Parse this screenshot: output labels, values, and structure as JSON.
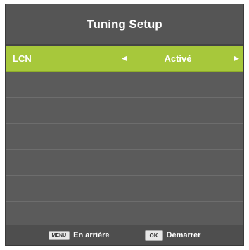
{
  "header": {
    "title": "Tuning Setup"
  },
  "menu": {
    "items": [
      {
        "label": "LCN",
        "value": "Activé"
      }
    ]
  },
  "footer": {
    "back": {
      "key": "MENU",
      "label": "En arrière"
    },
    "start": {
      "key": "OK",
      "label": "Démarrer"
    }
  },
  "colors": {
    "highlight": "#a7c83b",
    "background": "#5b5b5b"
  }
}
